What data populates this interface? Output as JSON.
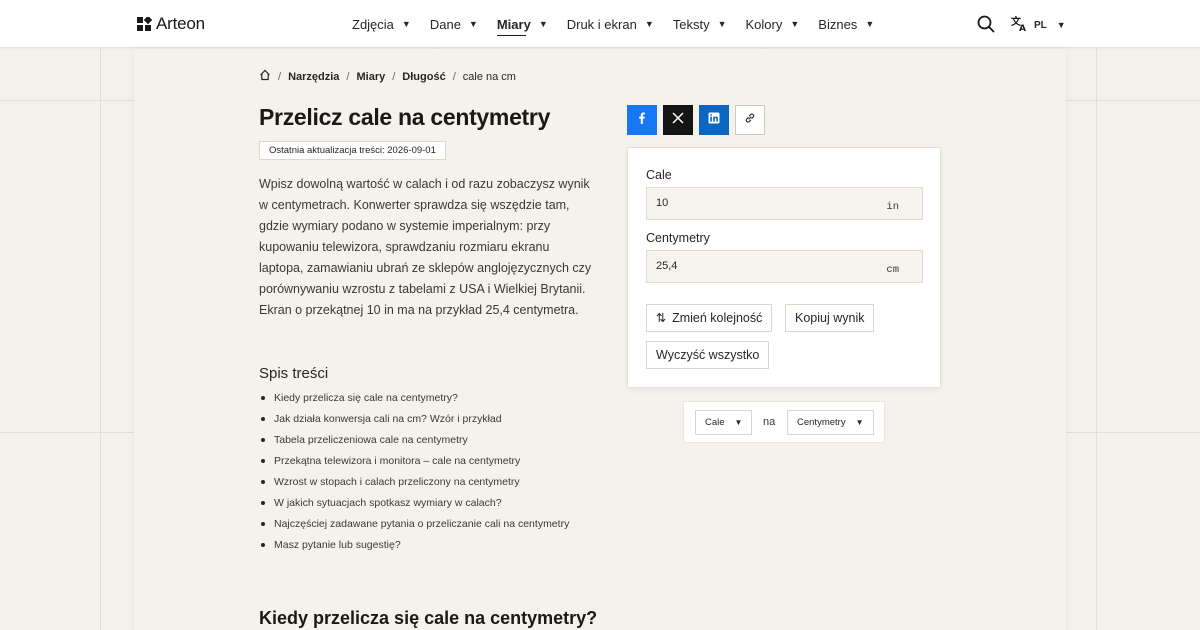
{
  "header": {
    "logo_text": "Arteon",
    "nav": [
      {
        "label": "Zdjęcia"
      },
      {
        "label": "Dane"
      },
      {
        "label": "Miary",
        "active": true
      },
      {
        "label": "Druk i ekran"
      },
      {
        "label": "Teksty"
      },
      {
        "label": "Kolory"
      },
      {
        "label": "Biznes"
      }
    ],
    "language": "PL",
    "icons": {
      "search": "search-icon",
      "translate": "translate-icon",
      "home": "home-icon"
    }
  },
  "breadcrumb": {
    "items": [
      "Narzędzia",
      "Miary",
      "Długość"
    ],
    "current": "cale na cm"
  },
  "article": {
    "title": "Przelicz cale na centymetry",
    "updated": "Ostatnia aktualizacja treści: 2026-09-01",
    "intro": "Wpisz dowolną wartość w calach i od razu zobaczysz wynik w centymetrach. Konwerter sprawdza się wszędzie tam, gdzie wymiary podano w systemie imperialnym: przy kupowaniu telewizora, sprawdzaniu rozmiaru ekranu laptopa, zamawianiu ubrań ze sklepów anglojęzycznych czy porównywaniu wzrostu z tabelami z USA i Wielkiej Brytanii. Ekran o przekątnej 10 in ma na przykład 25,4 centymetra.",
    "toc_title": "Spis treści",
    "toc": [
      "Kiedy przelicza się cale na centymetry?",
      "Jak działa konwersja cali na cm? Wzór i przykład",
      "Tabela przeliczeniowa cale na centymetry",
      "Przekątna telewizora i monitora – cale na centymetry",
      "Wzrost w stopach i calach przeliczony na centymetry",
      "W jakich sytuacjach spotkasz wymiary w calach?",
      "Najczęściej zadawane pytania o przeliczanie cali na centymetry",
      "Masz pytanie lub sugestię?"
    ],
    "section_heading": "Kiedy przelicza się cale na centymetry?"
  },
  "share": {
    "icons": [
      "facebook-icon",
      "x-icon",
      "linkedin-icon",
      "link-icon"
    ]
  },
  "converter": {
    "from_label": "Cale",
    "from_value": "10",
    "from_unit": "in",
    "to_label": "Centymetry",
    "to_value": "25,4",
    "to_unit": "cm",
    "swap_label": "Zmień kolejność",
    "copy_label": "Kopiuj wynik",
    "clear_label": "Wyczyść wszystko"
  },
  "unit_picker": {
    "from": "Cale",
    "connector": "na",
    "to": "Centymetry"
  },
  "colors": {
    "facebook": "#1877f2",
    "x": "#141414",
    "linkedin": "#0a66c2",
    "page_background": "#f4f0eb"
  }
}
